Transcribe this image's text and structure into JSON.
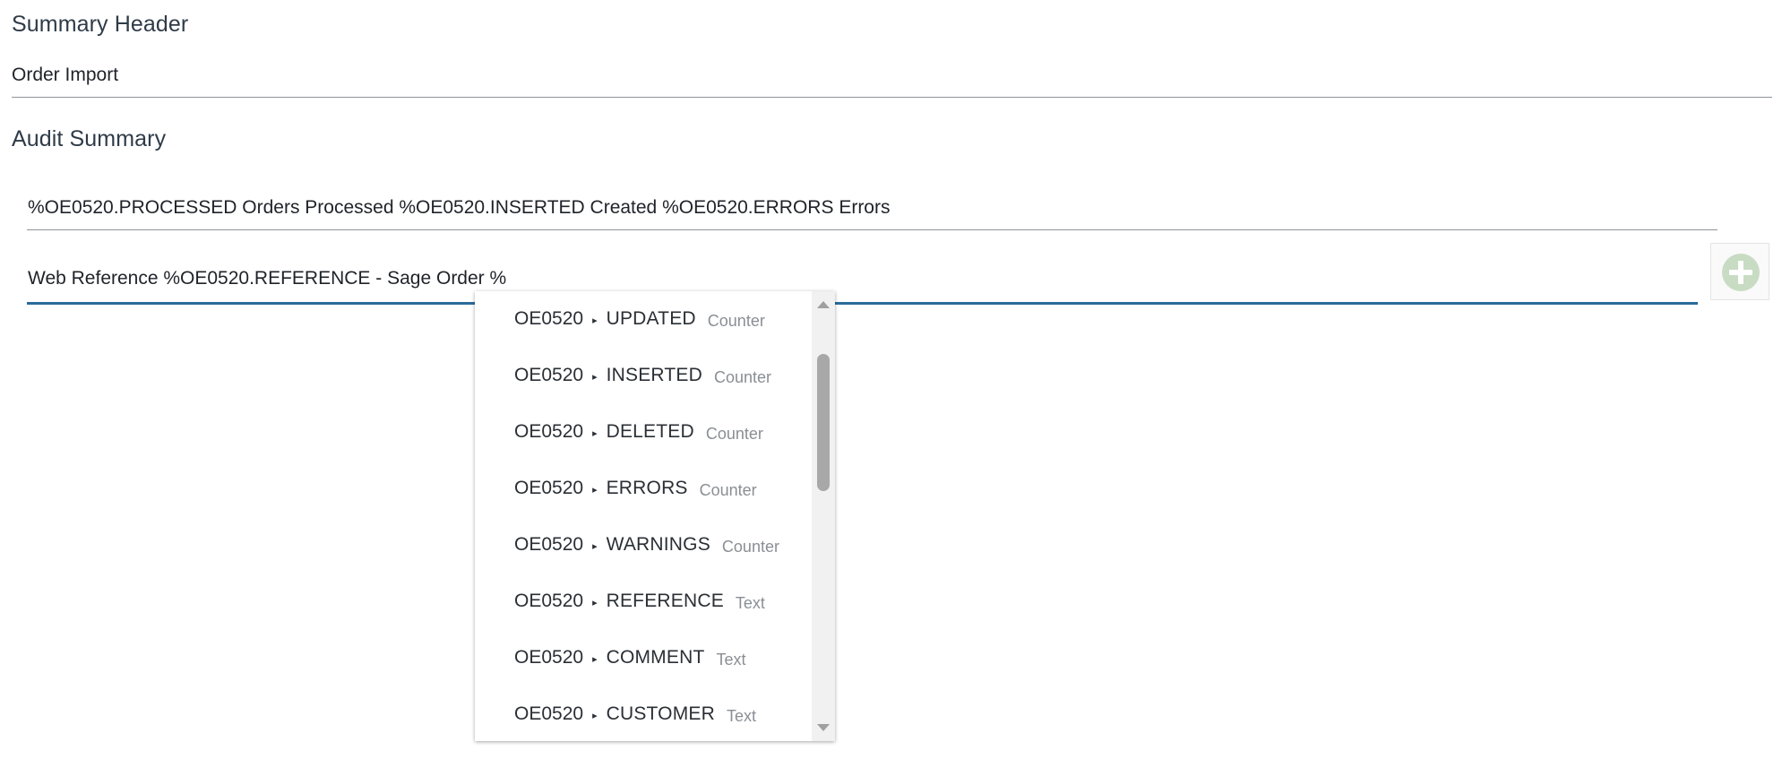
{
  "summary_header": {
    "title": "Summary Header",
    "value": "Order Import"
  },
  "audit_summary": {
    "title": "Audit Summary",
    "line1": "%OE0520.PROCESSED Orders Processed %OE0520.INSERTED Created %OE0520.ERRORS Errors",
    "line2": "Web Reference %OE0520.REFERENCE - Sage Order %"
  },
  "add_button": {
    "icon": "plus-circle-icon",
    "color": "#c8dcc4"
  },
  "autocomplete": {
    "arrow_glyph": "▸",
    "options": [
      {
        "ns": "OE0520",
        "name": "UPDATED",
        "type": "Counter"
      },
      {
        "ns": "OE0520",
        "name": "INSERTED",
        "type": "Counter"
      },
      {
        "ns": "OE0520",
        "name": "DELETED",
        "type": "Counter"
      },
      {
        "ns": "OE0520",
        "name": "ERRORS",
        "type": "Counter"
      },
      {
        "ns": "OE0520",
        "name": "WARNINGS",
        "type": "Counter"
      },
      {
        "ns": "OE0520",
        "name": "REFERENCE",
        "type": "Text"
      },
      {
        "ns": "OE0520",
        "name": "COMMENT",
        "type": "Text"
      },
      {
        "ns": "OE0520",
        "name": "CUSTOMER",
        "type": "Text"
      }
    ]
  },
  "colors": {
    "active_underline": "#2b6a99",
    "divider": "#8f9499",
    "heading": "#2f3b48"
  }
}
